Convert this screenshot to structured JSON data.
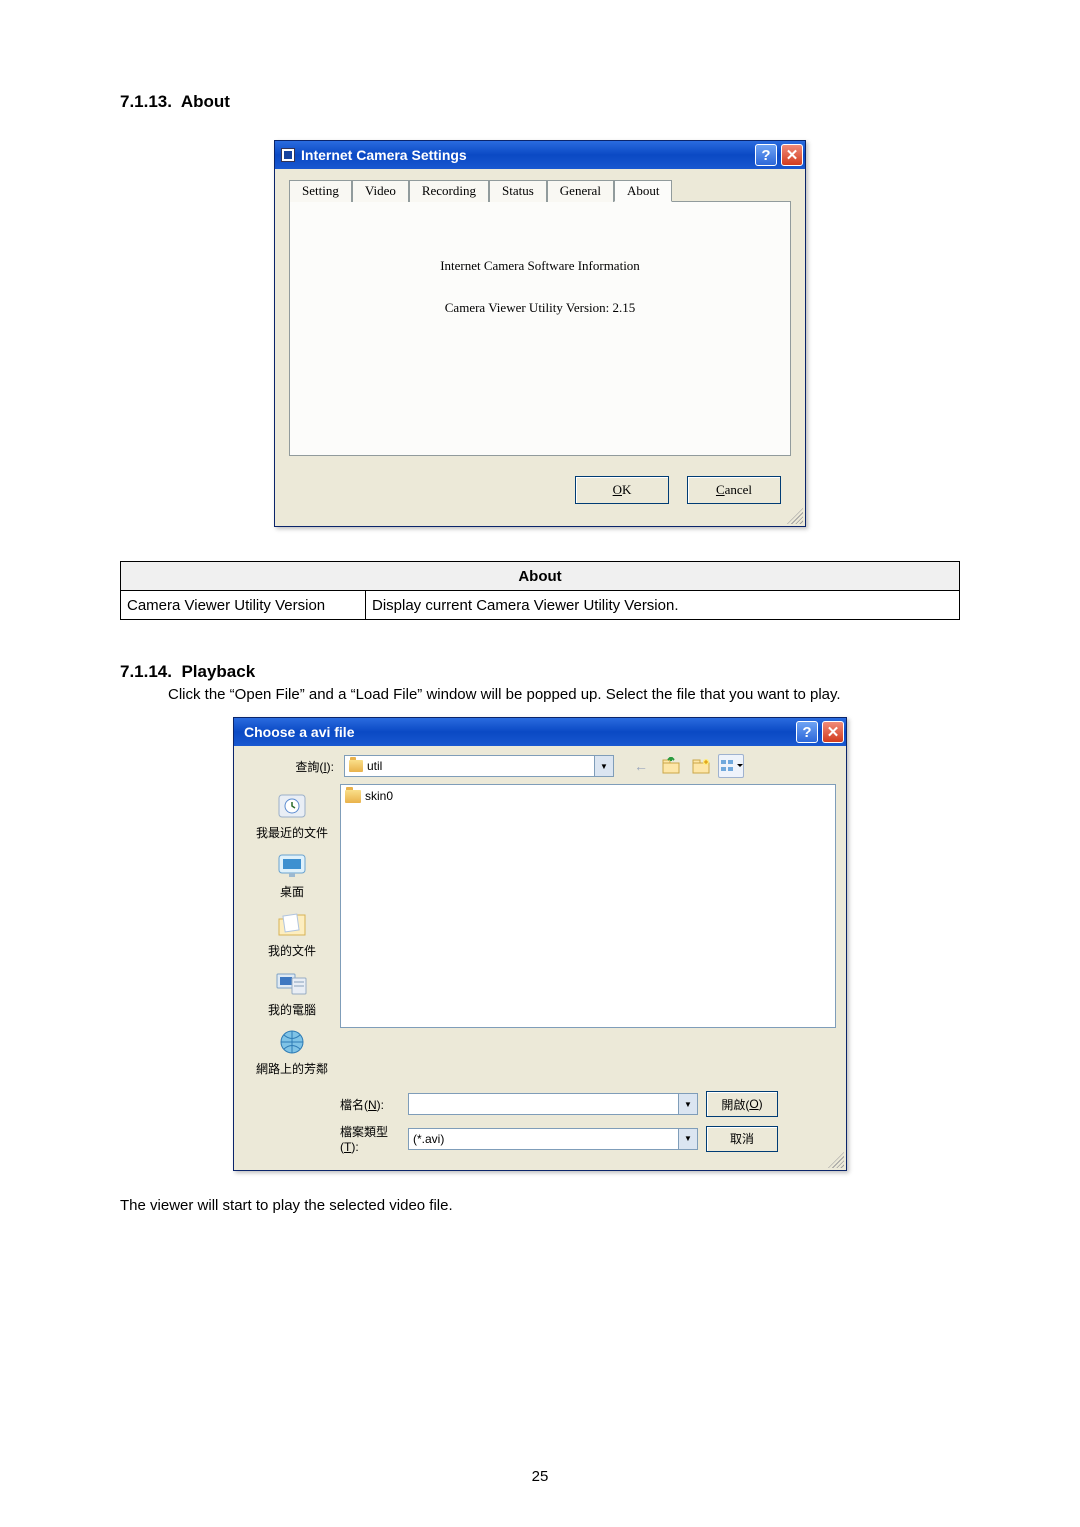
{
  "sec1": {
    "num": "7.1.13.",
    "title": "About"
  },
  "dlg1": {
    "title": "Internet Camera Settings",
    "tabs": [
      "Setting",
      "Video",
      "Recording",
      "Status",
      "General",
      "About"
    ],
    "active_tab_index": 5,
    "pane_line1": "Internet Camera Software Information",
    "pane_line2": "Camera Viewer Utility Version: 2.15",
    "ok_u": "O",
    "ok_rest": "K",
    "cancel_u": "C",
    "cancel_rest": "ancel"
  },
  "table_header": "About",
  "table_row_label": "Camera Viewer Utility Version",
  "table_row_value": "Display current Camera Viewer Utility Version.",
  "sec2": {
    "num": "7.1.14.",
    "title": "Playback"
  },
  "playback_text": "Click the “Open File” and a “Load File” window will be popped up. Select the file that you want to play.",
  "dlg2": {
    "title": "Choose a avi file",
    "lookin_label": "查詢(I):",
    "lookin_label_u": "I",
    "lookin_value": "util",
    "toolbar": {
      "back": "back-icon",
      "up": "up-one-level-icon",
      "newfolder": "new-folder-icon",
      "views": "views-icon"
    },
    "places": [
      "我最近的文件",
      "桌面",
      "我的文件",
      "我的電腦",
      "網路上的芳鄰"
    ],
    "file_item": "skin0",
    "fn_label_pre": "檔名(",
    "fn_label_u": "N",
    "fn_label_post": "):",
    "ft_label_pre": "檔案類型(",
    "ft_label_u": "T",
    "ft_label_post": "):",
    "filename_value": "",
    "filetype_value": "(*.avi)",
    "open_pre": "開啟(",
    "open_u": "O",
    "open_post": ")",
    "cancel": "取消"
  },
  "post_text": "The viewer will start to play the selected video file.",
  "page_number": "25"
}
